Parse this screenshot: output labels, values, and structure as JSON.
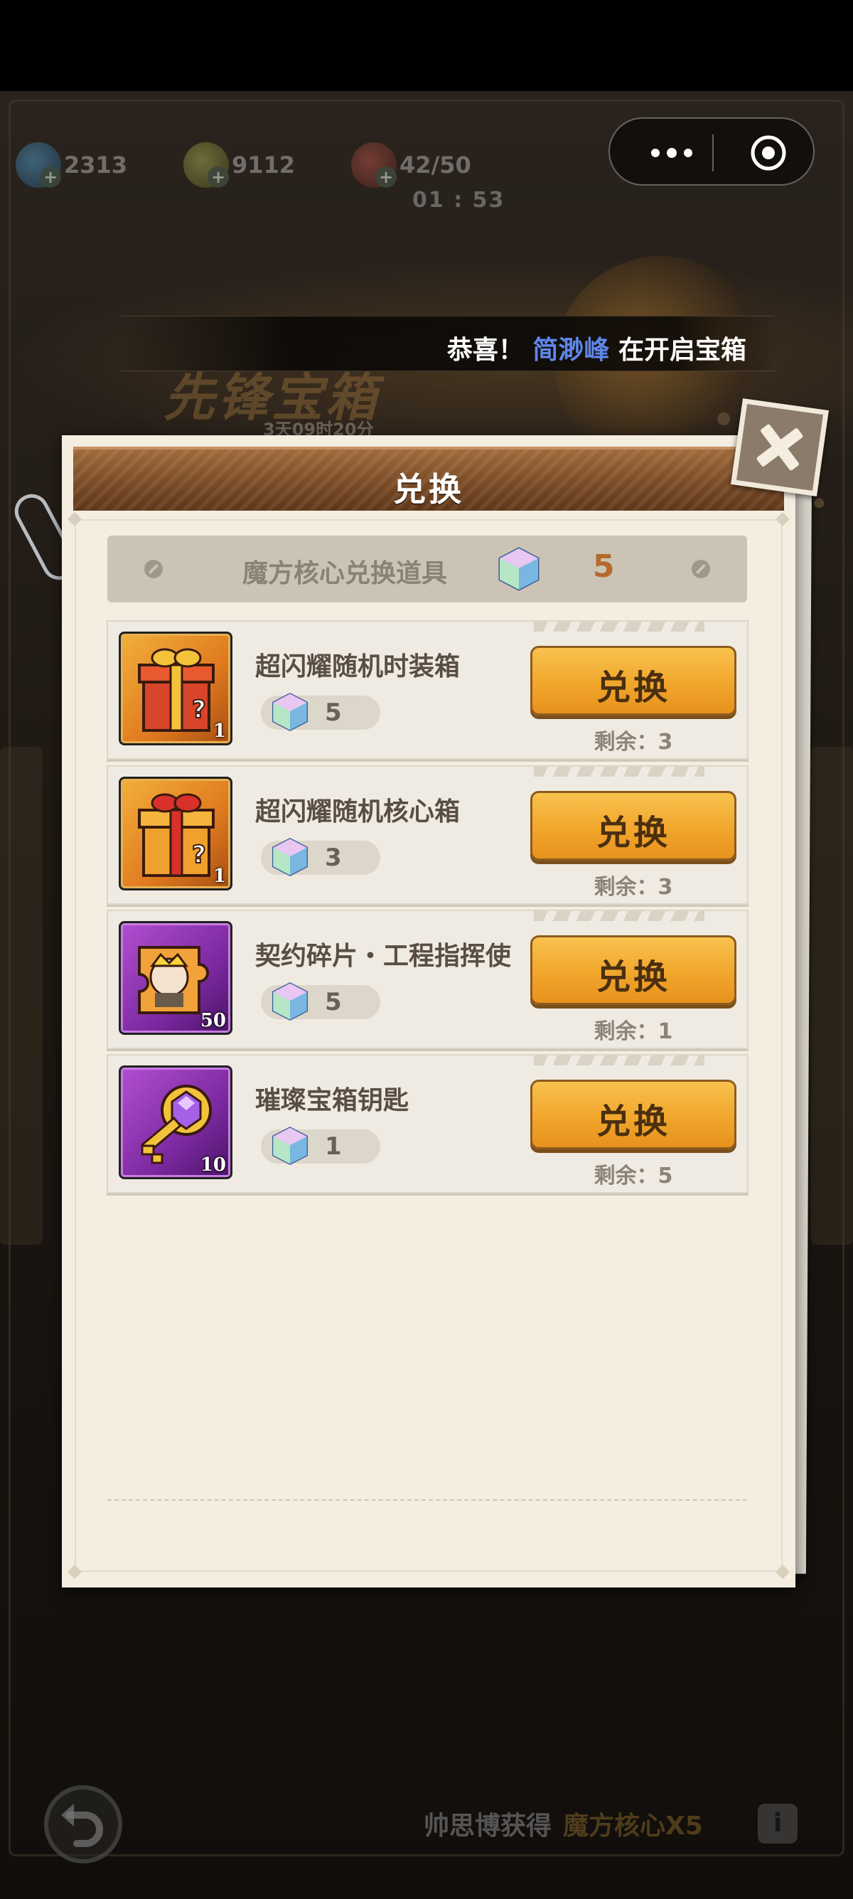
{
  "resources": [
    {
      "name": "diamond",
      "value": "2313"
    },
    {
      "name": "coin",
      "value": "9112"
    },
    {
      "name": "stamina",
      "value": "42/50"
    }
  ],
  "stamina_timer": "01 : 53",
  "marquee": {
    "prefix": "恭喜！",
    "player": "简渺峰",
    "suffix": "在开启宝箱"
  },
  "event": {
    "title": "先锋宝箱",
    "timer": "3天09时20分"
  },
  "modal": {
    "title": "兑换",
    "currency_label": "魔方核心兑换道具",
    "currency_count": "5",
    "items": [
      {
        "name": "超闪耀随机时装箱",
        "icon": "gift-box-icon",
        "qty": "1",
        "cost": "5",
        "button": "兑换",
        "remain": "剩余：3"
      },
      {
        "name": "超闪耀随机核心箱",
        "icon": "gift-box-icon",
        "qty": "1",
        "cost": "3",
        "button": "兑换",
        "remain": "剩余：3"
      },
      {
        "name": "契约碎片・工程指挥使",
        "icon": "puzzle-fragment-icon",
        "qty": "50",
        "cost": "5",
        "button": "兑换",
        "remain": "剩余：1"
      },
      {
        "name": "璀璨宝箱钥匙",
        "icon": "key-icon",
        "qty": "10",
        "cost": "1",
        "button": "兑换",
        "remain": "剩余：5"
      }
    ]
  },
  "bottom": {
    "who": "帅思博获得",
    "what": "魔方核心X5",
    "info_icon": "i"
  },
  "colors": {
    "accent_gold": "#f1a62c",
    "player_name": "#5f86e8",
    "header_brown": "#7a4b26",
    "currency_orange": "#b5692c"
  }
}
